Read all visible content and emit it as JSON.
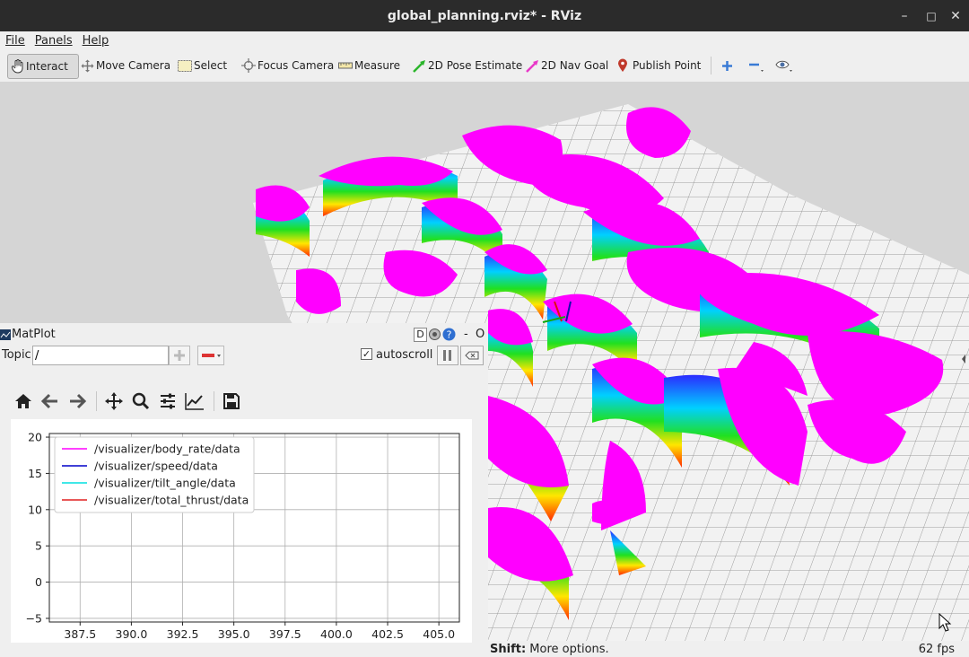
{
  "window": {
    "title": "global_planning.rviz* - RViz",
    "minimize": "–",
    "maximize": "□",
    "close": "✕"
  },
  "menu": {
    "file": "File",
    "panels": "Panels",
    "help": "Help"
  },
  "toolbar": {
    "interact": "Interact",
    "move_camera": "Move Camera",
    "select": "Select",
    "focus_camera": "Focus Camera",
    "measure": "Measure",
    "pose_estimate": "2D Pose Estimate",
    "nav_goal": "2D Nav Goal",
    "publish_point": "Publish Point"
  },
  "matplot": {
    "title": "MatPlot",
    "buttons": {
      "d": "D",
      "minimize": "-",
      "close": "O"
    },
    "topic_label": "Topic",
    "topic_value": "/",
    "autoscroll_label": "autoscroll",
    "autoscroll_checked": true
  },
  "status": {
    "hint_key": "Shift:",
    "hint_text": " More options.",
    "fps": "62 fps"
  },
  "chart_data": {
    "type": "line",
    "title": "",
    "xlabel": "",
    "ylabel": "",
    "xlim": [
      386,
      406
    ],
    "ylim": [
      -5.5,
      20.5
    ],
    "x_ticks": [
      "387.5",
      "390.0",
      "392.5",
      "395.0",
      "397.5",
      "400.0",
      "402.5",
      "405.0"
    ],
    "x_tick_values": [
      387.5,
      390.0,
      392.5,
      395.0,
      397.5,
      400.0,
      402.5,
      405.0
    ],
    "y_ticks": [
      "20",
      "15",
      "10",
      "5",
      "0",
      "−5"
    ],
    "y_tick_values": [
      20,
      15,
      10,
      5,
      0,
      -5
    ],
    "grid": true,
    "legend_position": "upper-left",
    "series": [
      {
        "name": "/visualizer/body_rate/data",
        "color": "#ff00ff",
        "values": []
      },
      {
        "name": "/visualizer/speed/data",
        "color": "#0000c8",
        "values": []
      },
      {
        "name": "/visualizer/tilt_angle/data",
        "color": "#00e0e0",
        "values": []
      },
      {
        "name": "/visualizer/total_thrust/data",
        "color": "#e02020",
        "values": []
      }
    ]
  },
  "colors": {
    "obstacle_top": "#ff00ff",
    "grid_floor": "#f0f0f0",
    "panel_bg": "#efefef",
    "titlebar": "#2b2b2b"
  }
}
